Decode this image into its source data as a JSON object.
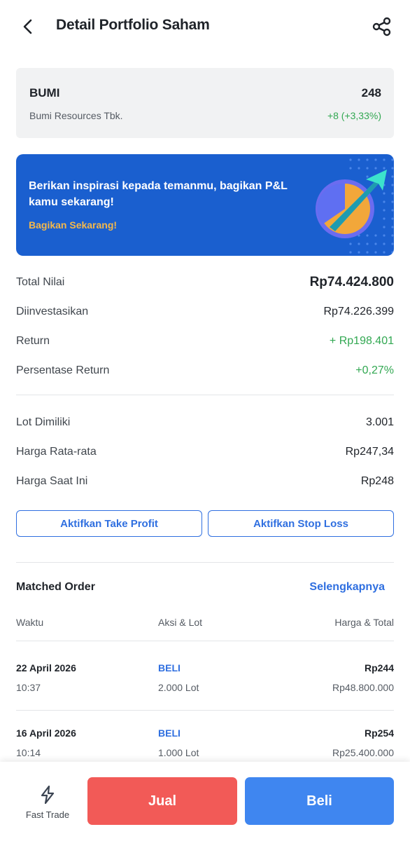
{
  "header": {
    "title": "Detail Portfolio Saham",
    "back_icon": "chevron-left-icon",
    "share_icon": "share-icon"
  },
  "stock": {
    "code": "BUMI",
    "price": "248",
    "name": "Bumi Resources Tbk.",
    "change": "+8 (+3,33%)",
    "change_color": "#32a852"
  },
  "banner": {
    "text": "Berikan inspirasi kepada temanmu, bagikan P&L kamu sekarang!",
    "cta": "Bagikan Sekarang!",
    "bg_color": "#1a5fcf",
    "cta_color": "#f5b84a"
  },
  "summary": {
    "total_nilai_label": "Total Nilai",
    "total_nilai_value": "Rp74.424.800",
    "diinvestasikan_label": "Diinvestasikan",
    "diinvestasikan_value": "Rp74.226.399",
    "return_label": "Return",
    "return_value": "+ Rp198.401",
    "persentase_label": "Persentase Return",
    "persentase_value": "+0,27%"
  },
  "holding": {
    "lot_label": "Lot Dimiliki",
    "lot_value": "3.001",
    "avg_label": "Harga Rata-rata",
    "avg_value": "Rp247,34",
    "current_label": "Harga Saat Ini",
    "current_value": "Rp248"
  },
  "actions": {
    "take_profit": "Aktifkan Take Profit",
    "stop_loss": "Aktifkan Stop Loss"
  },
  "matched_order": {
    "title": "Matched Order",
    "more": "Selengkapnya",
    "columns": [
      "Waktu",
      "Aksi & Lot",
      "Harga & Total"
    ],
    "rows": [
      {
        "date": "22 April 2026",
        "time": "10:37",
        "action": "BELI",
        "lot": "2.000 Lot",
        "price": "Rp244",
        "total": "Rp48.800.000"
      },
      {
        "date": "16 April 2026",
        "time": "10:14",
        "action": "BELI",
        "lot": "1.000 Lot",
        "price": "Rp254",
        "total": "Rp25.400.000"
      }
    ]
  },
  "bottom_bar": {
    "fast_trade": "Fast Trade",
    "fast_trade_icon": "lightning-icon",
    "sell": "Jual",
    "buy": "Beli",
    "sell_color": "#f25a57",
    "buy_color": "#3f86f0"
  }
}
